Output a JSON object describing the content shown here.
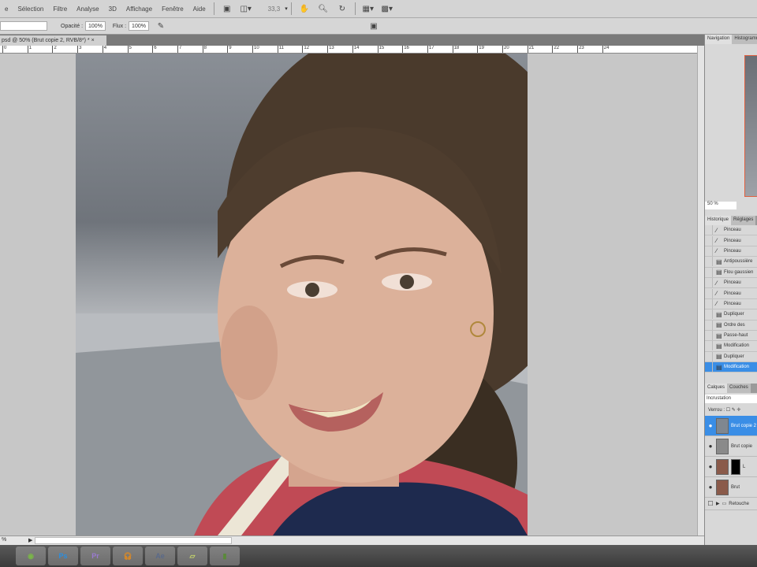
{
  "menu": [
    "e",
    "Sélection",
    "Filtre",
    "Analyse",
    "3D",
    "Affichage",
    "Fenêtre",
    "Aide"
  ],
  "toolbar": {
    "zoom_value": "33,3"
  },
  "options": {
    "opacity_label": "Opacité :",
    "opacity_value": "100%",
    "flow_label": "Flux :",
    "flow_value": "100%"
  },
  "document": {
    "tab_title": "psd @ 50% (Brut copie 2, RVB/8*) *",
    "close": "×"
  },
  "ruler": [
    "0",
    "1",
    "2",
    "3",
    "4",
    "5",
    "6",
    "7",
    "8",
    "9",
    "10",
    "11",
    "12",
    "13",
    "14",
    "15",
    "16",
    "17",
    "18",
    "19",
    "20",
    "21",
    "22",
    "23",
    "24"
  ],
  "status": {
    "zoom": "%"
  },
  "navigator": {
    "tabs": [
      "Navigation",
      "Histogramme"
    ],
    "zoom": "50 %"
  },
  "history": {
    "tabs": [
      "Historique",
      "Réglages"
    ],
    "items": [
      {
        "label": "Pinceau",
        "icon": "brush"
      },
      {
        "label": "Pinceau",
        "icon": "brush"
      },
      {
        "label": "Pinceau",
        "icon": "brush"
      },
      {
        "label": "Antipoussière",
        "icon": "doc"
      },
      {
        "label": "Flou gaussien",
        "icon": "doc"
      },
      {
        "label": "Pinceau",
        "icon": "brush"
      },
      {
        "label": "Pinceau",
        "icon": "brush"
      },
      {
        "label": "Pinceau",
        "icon": "brush"
      },
      {
        "label": "Dupliquer",
        "icon": "doc"
      },
      {
        "label": "Ordre des",
        "icon": "doc"
      },
      {
        "label": "Passe-haut",
        "icon": "doc"
      },
      {
        "label": "Modification",
        "icon": "doc"
      },
      {
        "label": "Dupliquer",
        "icon": "doc"
      },
      {
        "label": "Modification",
        "icon": "doc",
        "selected": true
      }
    ]
  },
  "layers": {
    "tabs": [
      "Calques",
      "Couches"
    ],
    "blend_mode": "Incrustation",
    "lock_label": "Verrou :",
    "items": [
      {
        "name": "Brut copie 2",
        "selected": true
      },
      {
        "name": "Brut copie"
      },
      {
        "name": "L"
      },
      {
        "name": "Brut"
      },
      {
        "name": "Retouche",
        "group": true
      }
    ]
  },
  "taskbar": [
    "Spotify",
    "Ps",
    "Pr",
    "Audacity",
    "AE",
    "Notes",
    "Camtasia"
  ]
}
